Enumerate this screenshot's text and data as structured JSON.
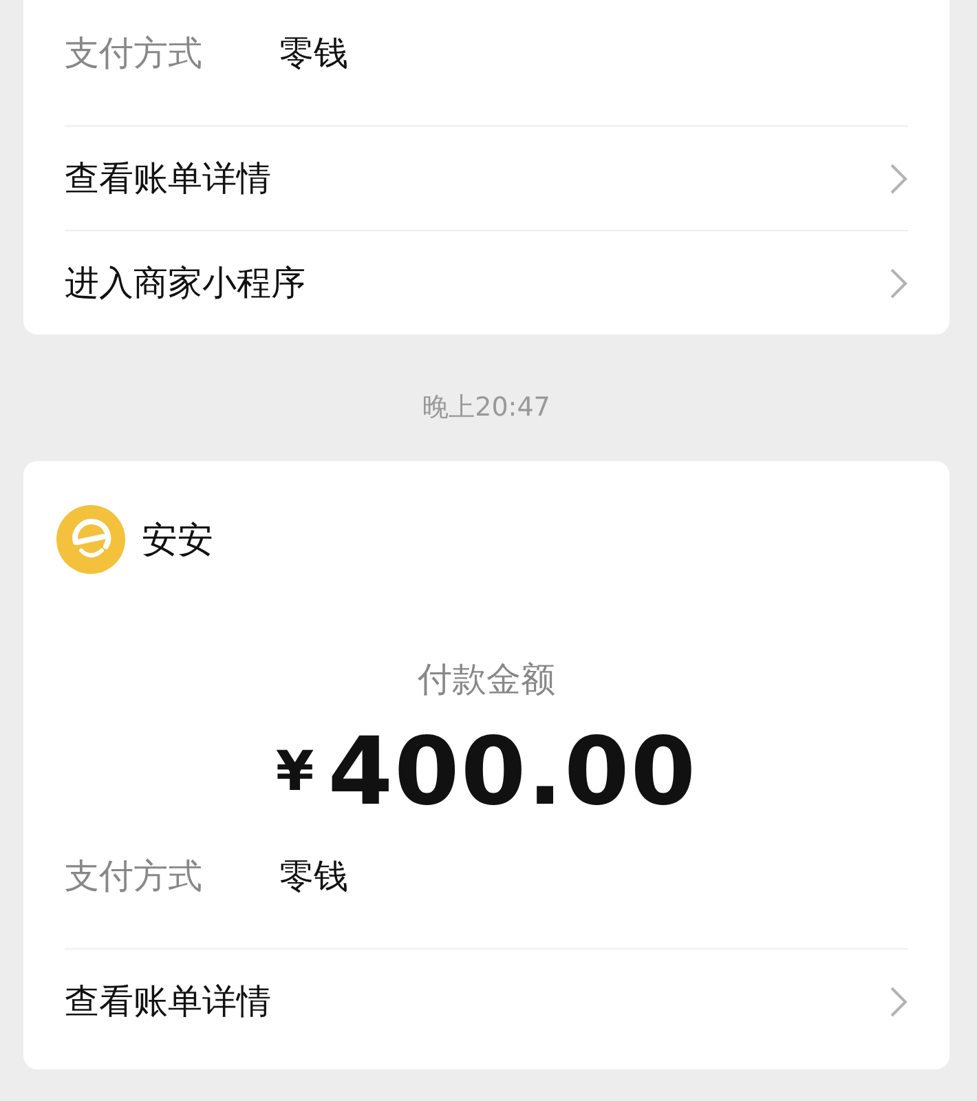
{
  "cards": [
    {
      "payment": {
        "label": "支付方式",
        "value": "零钱"
      },
      "links": [
        "查看账单详情",
        "进入商家小程序"
      ]
    },
    {
      "header": {
        "name": "安安"
      },
      "amount_label": "付款金额",
      "amount": {
        "currency": "¥",
        "value": "400.00"
      },
      "payment": {
        "label": "支付方式",
        "value": "零钱"
      },
      "links": [
        "查看账单详情"
      ]
    }
  ],
  "timestamp": "晚上20:47"
}
